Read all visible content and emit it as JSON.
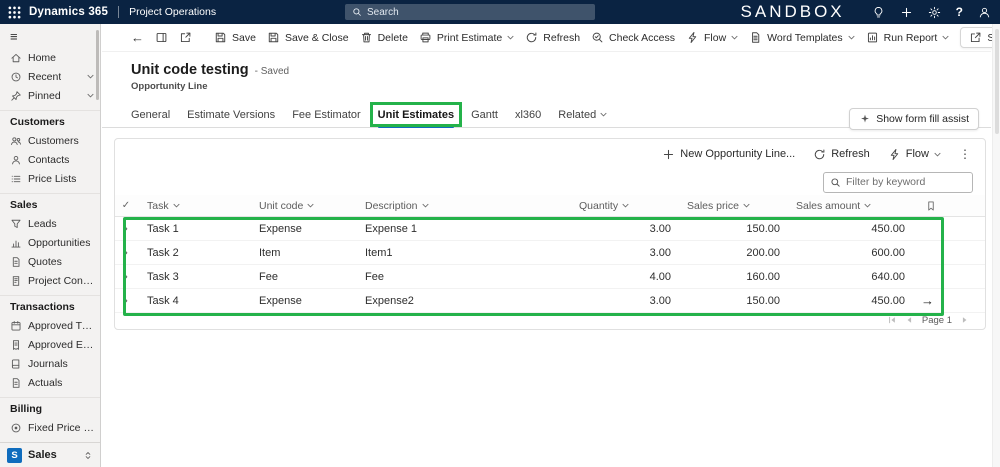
{
  "topbar": {
    "app_name": "Dynamics 365",
    "area_name": "Project Operations",
    "search_placeholder": "Search",
    "environment_label": "SANDBOX"
  },
  "sidebar": {
    "top_items": [
      {
        "label": "Home"
      },
      {
        "label": "Recent"
      },
      {
        "label": "Pinned"
      }
    ],
    "sections": [
      {
        "header": "Customers",
        "items": [
          {
            "label": "Customers"
          },
          {
            "label": "Contacts"
          },
          {
            "label": "Price Lists"
          }
        ]
      },
      {
        "header": "Sales",
        "items": [
          {
            "label": "Leads"
          },
          {
            "label": "Opportunities"
          },
          {
            "label": "Quotes"
          },
          {
            "label": "Project Contracts"
          }
        ]
      },
      {
        "header": "Transactions",
        "items": [
          {
            "label": "Approved Time"
          },
          {
            "label": "Approved Expenses"
          },
          {
            "label": "Journals"
          },
          {
            "label": "Actuals"
          }
        ]
      },
      {
        "header": "Billing",
        "items": [
          {
            "label": "Fixed Price Milest..."
          }
        ]
      }
    ],
    "area_switcher": {
      "badge": "S",
      "label": "Sales"
    }
  },
  "command_bar": {
    "buttons": [
      {
        "label": "Save"
      },
      {
        "label": "Save & Close"
      },
      {
        "label": "Delete"
      },
      {
        "label": "Print Estimate",
        "dropdown": true
      },
      {
        "label": "Refresh"
      },
      {
        "label": "Check Access"
      },
      {
        "label": "Flow",
        "dropdown": true
      },
      {
        "label": "Word Templates",
        "dropdown": true
      },
      {
        "label": "Run Report",
        "dropdown": true
      }
    ],
    "share_label": "Share"
  },
  "record": {
    "title": "Unit code testing",
    "status": "- Saved",
    "entity": "Opportunity Line"
  },
  "tabs": {
    "items": [
      "General",
      "Estimate Versions",
      "Fee Estimator",
      "Unit Estimates",
      "Gantt",
      "xl360",
      "Related"
    ],
    "selected": "Unit Estimates",
    "form_fill_assist_label": "Show form fill assist"
  },
  "grid": {
    "toolbar": {
      "new_label": "New Opportunity Line...",
      "refresh_label": "Refresh",
      "flow_label": "Flow"
    },
    "filter_placeholder": "Filter by keyword",
    "columns": [
      "Task",
      "Unit code",
      "Description",
      "Quantity",
      "Sales price",
      "Sales amount"
    ],
    "rows": [
      {
        "task": "Task 1",
        "unit_code": "Expense",
        "description": "Expense 1",
        "quantity": "3.00",
        "sales_price": "150.00",
        "sales_amount": "450.00"
      },
      {
        "task": "Task 2",
        "unit_code": "Item",
        "description": "Item1",
        "quantity": "3.00",
        "sales_price": "200.00",
        "sales_amount": "600.00"
      },
      {
        "task": "Task 3",
        "unit_code": "Fee",
        "description": "Fee",
        "quantity": "4.00",
        "sales_price": "160.00",
        "sales_amount": "640.00"
      },
      {
        "task": "Task 4",
        "unit_code": "Expense",
        "description": "Expense2",
        "quantity": "3.00",
        "sales_price": "150.00",
        "sales_amount": "450.00"
      }
    ],
    "pagination_label": "Page 1"
  },
  "colors": {
    "topbar_bg": "#0a2342",
    "annotation_green": "#24b24a",
    "accent_blue": "#0f6cbd"
  }
}
